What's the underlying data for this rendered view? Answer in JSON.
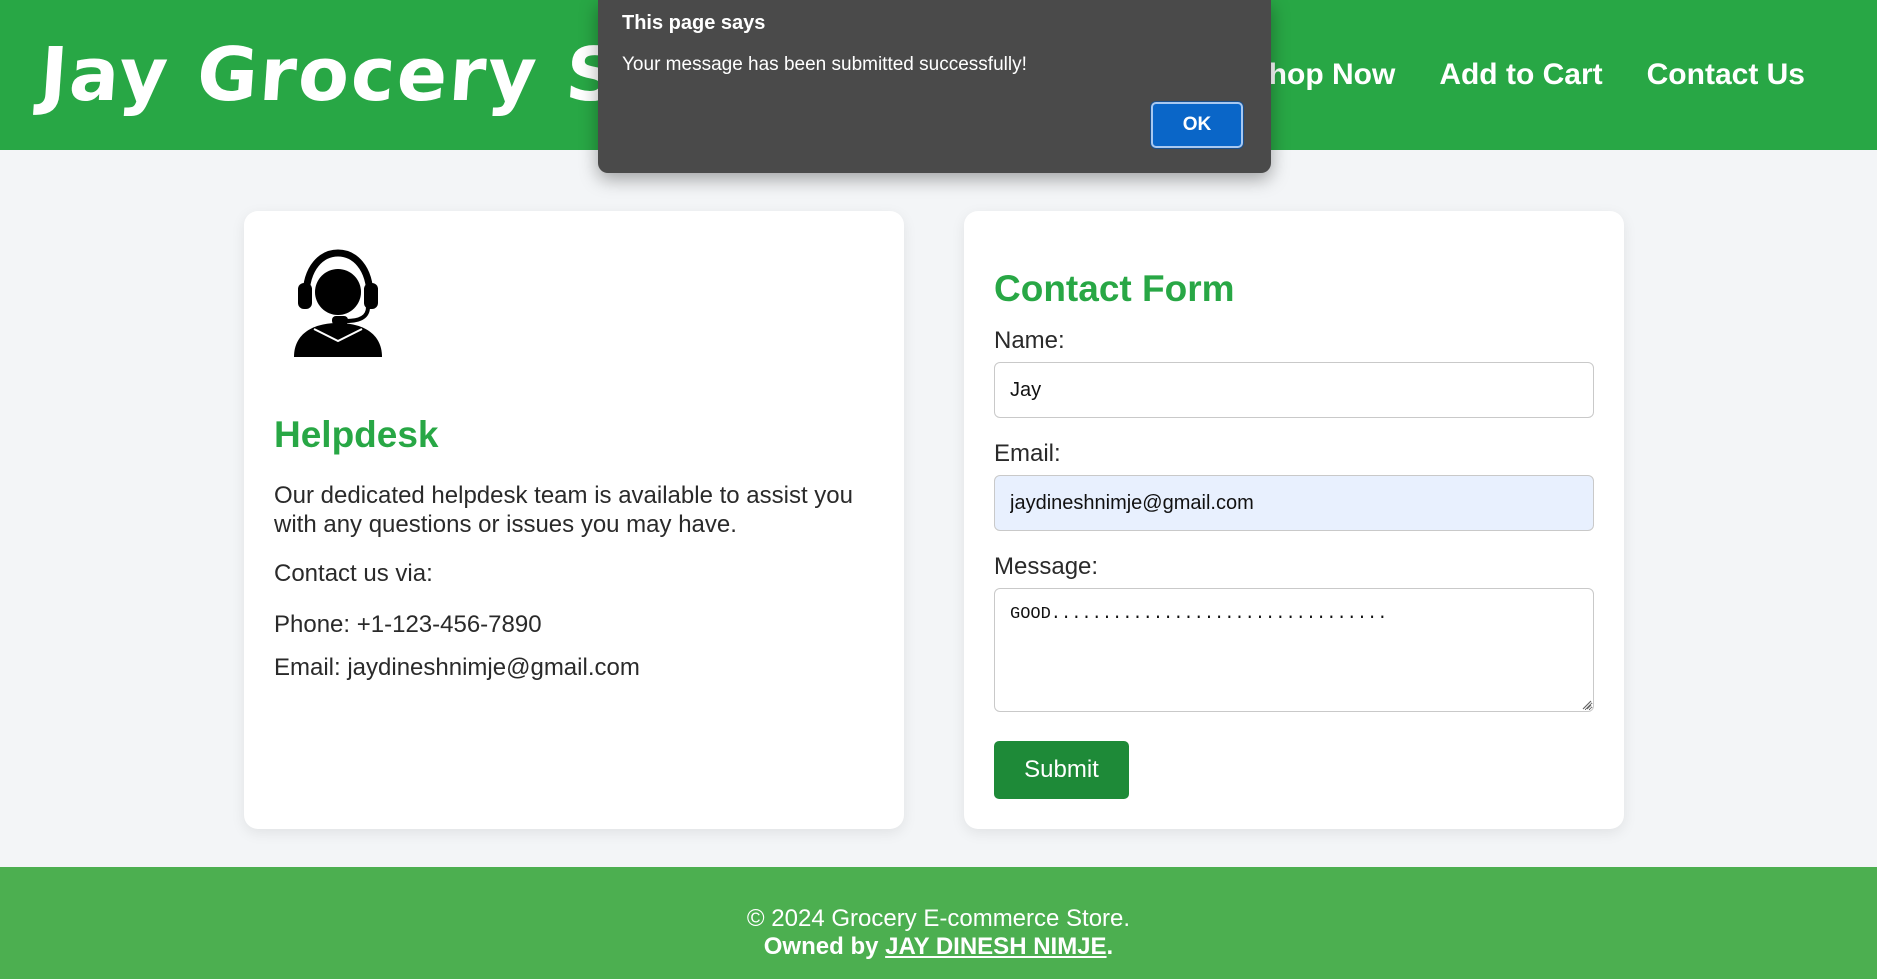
{
  "header": {
    "logo": "Jay Grocery Store",
    "nav": [
      {
        "label": "Shop Now"
      },
      {
        "label": "Add to Cart"
      },
      {
        "label": "Contact Us"
      }
    ]
  },
  "helpdesk": {
    "icon": "support-agent-icon",
    "title": "Helpdesk",
    "description": "Our dedicated helpdesk team is available to assist you with any questions or issues you may have.",
    "contact_via": "Contact us via:",
    "phone": "Phone: +1-123-456-7890",
    "email": "Email: jaydineshnimje@gmail.com"
  },
  "contact_form": {
    "title": "Contact Form",
    "name_label": "Name:",
    "name_value": "Jay",
    "email_label": "Email:",
    "email_value": "jaydineshnimje@gmail.com",
    "message_label": "Message:",
    "message_value": "GOOD.................................",
    "submit_label": "Submit"
  },
  "footer": {
    "copyright": "© 2024 Grocery E-commerce Store.",
    "owned_by": "Owned by",
    "owner": "JAY DINESH NIMJE",
    "period": "."
  },
  "dialog": {
    "title": "This page says",
    "message": "Your message has been submitted successfully!",
    "ok_label": "OK"
  },
  "colors": {
    "brand_green": "#28a745",
    "footer_green": "#4caf50",
    "button_green": "#1e8a38",
    "dialog_bg": "#4a4a4a",
    "ok_blue": "#0a66c8"
  }
}
